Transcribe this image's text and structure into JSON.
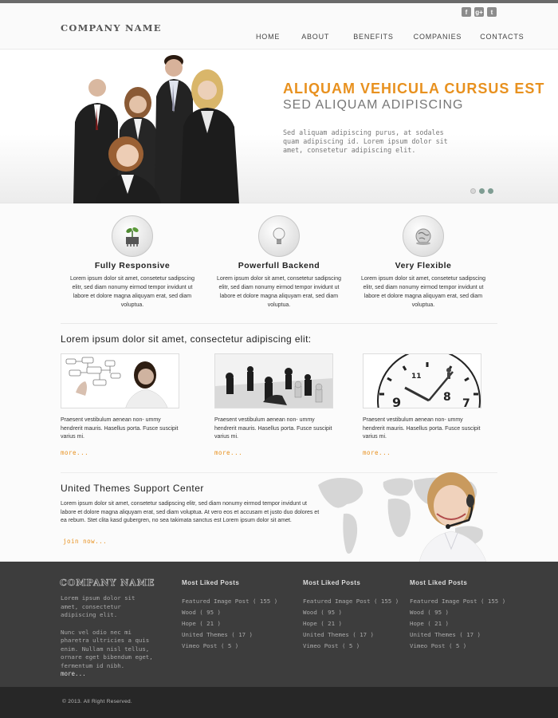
{
  "header": {
    "logo": "COMPANY NAME",
    "social_icons": [
      "facebook-icon",
      "google-plus-icon",
      "twitter-icon"
    ],
    "nav": [
      "HOME",
      "ABOUT",
      "BENEFITS",
      "COMPANIES",
      "CONTACTS"
    ]
  },
  "hero": {
    "title": "ALIQUAM VEHICULA CURSUS EST",
    "subtitle": "SED ALIQUAM ADIPISCING",
    "text": "Sed aliquam adipiscing purus, at sodales quam adipiscing id. Lorem ipsum dolor sit amet, consetetur adipiscing elit.",
    "slides": 3,
    "active_slide": 1
  },
  "features": [
    {
      "icon": "plant-chip-icon",
      "title": "Fully Responsive",
      "text": "Lorem ipsum dolor sit amet, consetetur sadipscing elitr, sed diam nonumy eirmod tempor invidunt ut labore et dolore magna aliquyam erat, sed diam voluptua."
    },
    {
      "icon": "lightbulb-icon",
      "title": "Powerfull Backend",
      "text": "Lorem ipsum dolor sit amet, consetetur sadipscing elitr, sed diam nonumy eirmod tempor invidunt ut labore et dolore magna aliquyam erat, sed diam voluptua."
    },
    {
      "icon": "globe-icon",
      "title": "Very Flexible",
      "text": "Lorem ipsum dolor sit amet, consetetur sadipscing elitr, sed diam nonumy eirmod tempor invidunt ut labore et dolore magna aliquyam erat, sed diam voluptua."
    }
  ],
  "posts_section": {
    "title": "Lorem ipsum dolor sit amet, consectetur adipiscing elit:",
    "posts": [
      {
        "text": "Praesent vestibulum aenean non- ummy hendrerit mauris. Hasellus porta. Fusce suscipit varius mi.",
        "more": "more..."
      },
      {
        "text": "Praesent vestibulum aenean non- ummy hendrerit mauris. Hasellus porta. Fusce suscipit varius mi.",
        "more": "more..."
      },
      {
        "text": "Praesent vestibulum aenean non- ummy hendrerit mauris. Hasellus porta. Fusce suscipit varius mi.",
        "more": "more..."
      }
    ]
  },
  "support": {
    "title": "United Themes Support Center",
    "text": "Lorem ipsum dolor sit amet, consetetur sadipscing elitr, sed diam nonumy eirmod tempor invidunt ut labore et dolore magna aliquyam erat, sed diam voluptua. At vero eos et accusam et justo duo dolores et ea rebum. Stet clita kasd gubergren, no sea takimata sanctus est Lorem ipsum dolor sit amet.",
    "join": "join now..."
  },
  "footer": {
    "logo": "COMPANY NAME",
    "about1": "Lorem ipsum dolor sit amet, consectetur adipiscing elit.",
    "about2": "Nunc vel odio nec mi pharetra ultricies a quis enim. Nullam nisl tellus, ornare eget bibendum eget, fermentum id nibh.",
    "more": "more...",
    "columns": [
      {
        "title": "Most Liked Posts",
        "items": [
          "Featured Image Post ( 155 )",
          "Wood ( 95 )",
          "Hope ( 21 )",
          "United Themes ( 17 )",
          "Vimeo Post ( 5 )"
        ]
      },
      {
        "title": "Most Liked Posts",
        "items": [
          "Featured Image Post ( 155 )",
          "Wood ( 95 )",
          "Hope ( 21 )",
          "United Themes ( 17 )",
          "Vimeo Post ( 5 )"
        ]
      },
      {
        "title": "Most Liked Posts",
        "items": [
          "Featured Image Post ( 155 )",
          "Wood ( 95 )",
          "Hope ( 21 )",
          "United Themes ( 17 )",
          "Vimeo Post ( 5 )"
        ]
      }
    ],
    "copyright": "© 2013. All Right Reserved."
  },
  "colors": {
    "accent": "#e8911f",
    "footer_bg": "#3d3d3d",
    "bottom_bar": "#272727"
  }
}
